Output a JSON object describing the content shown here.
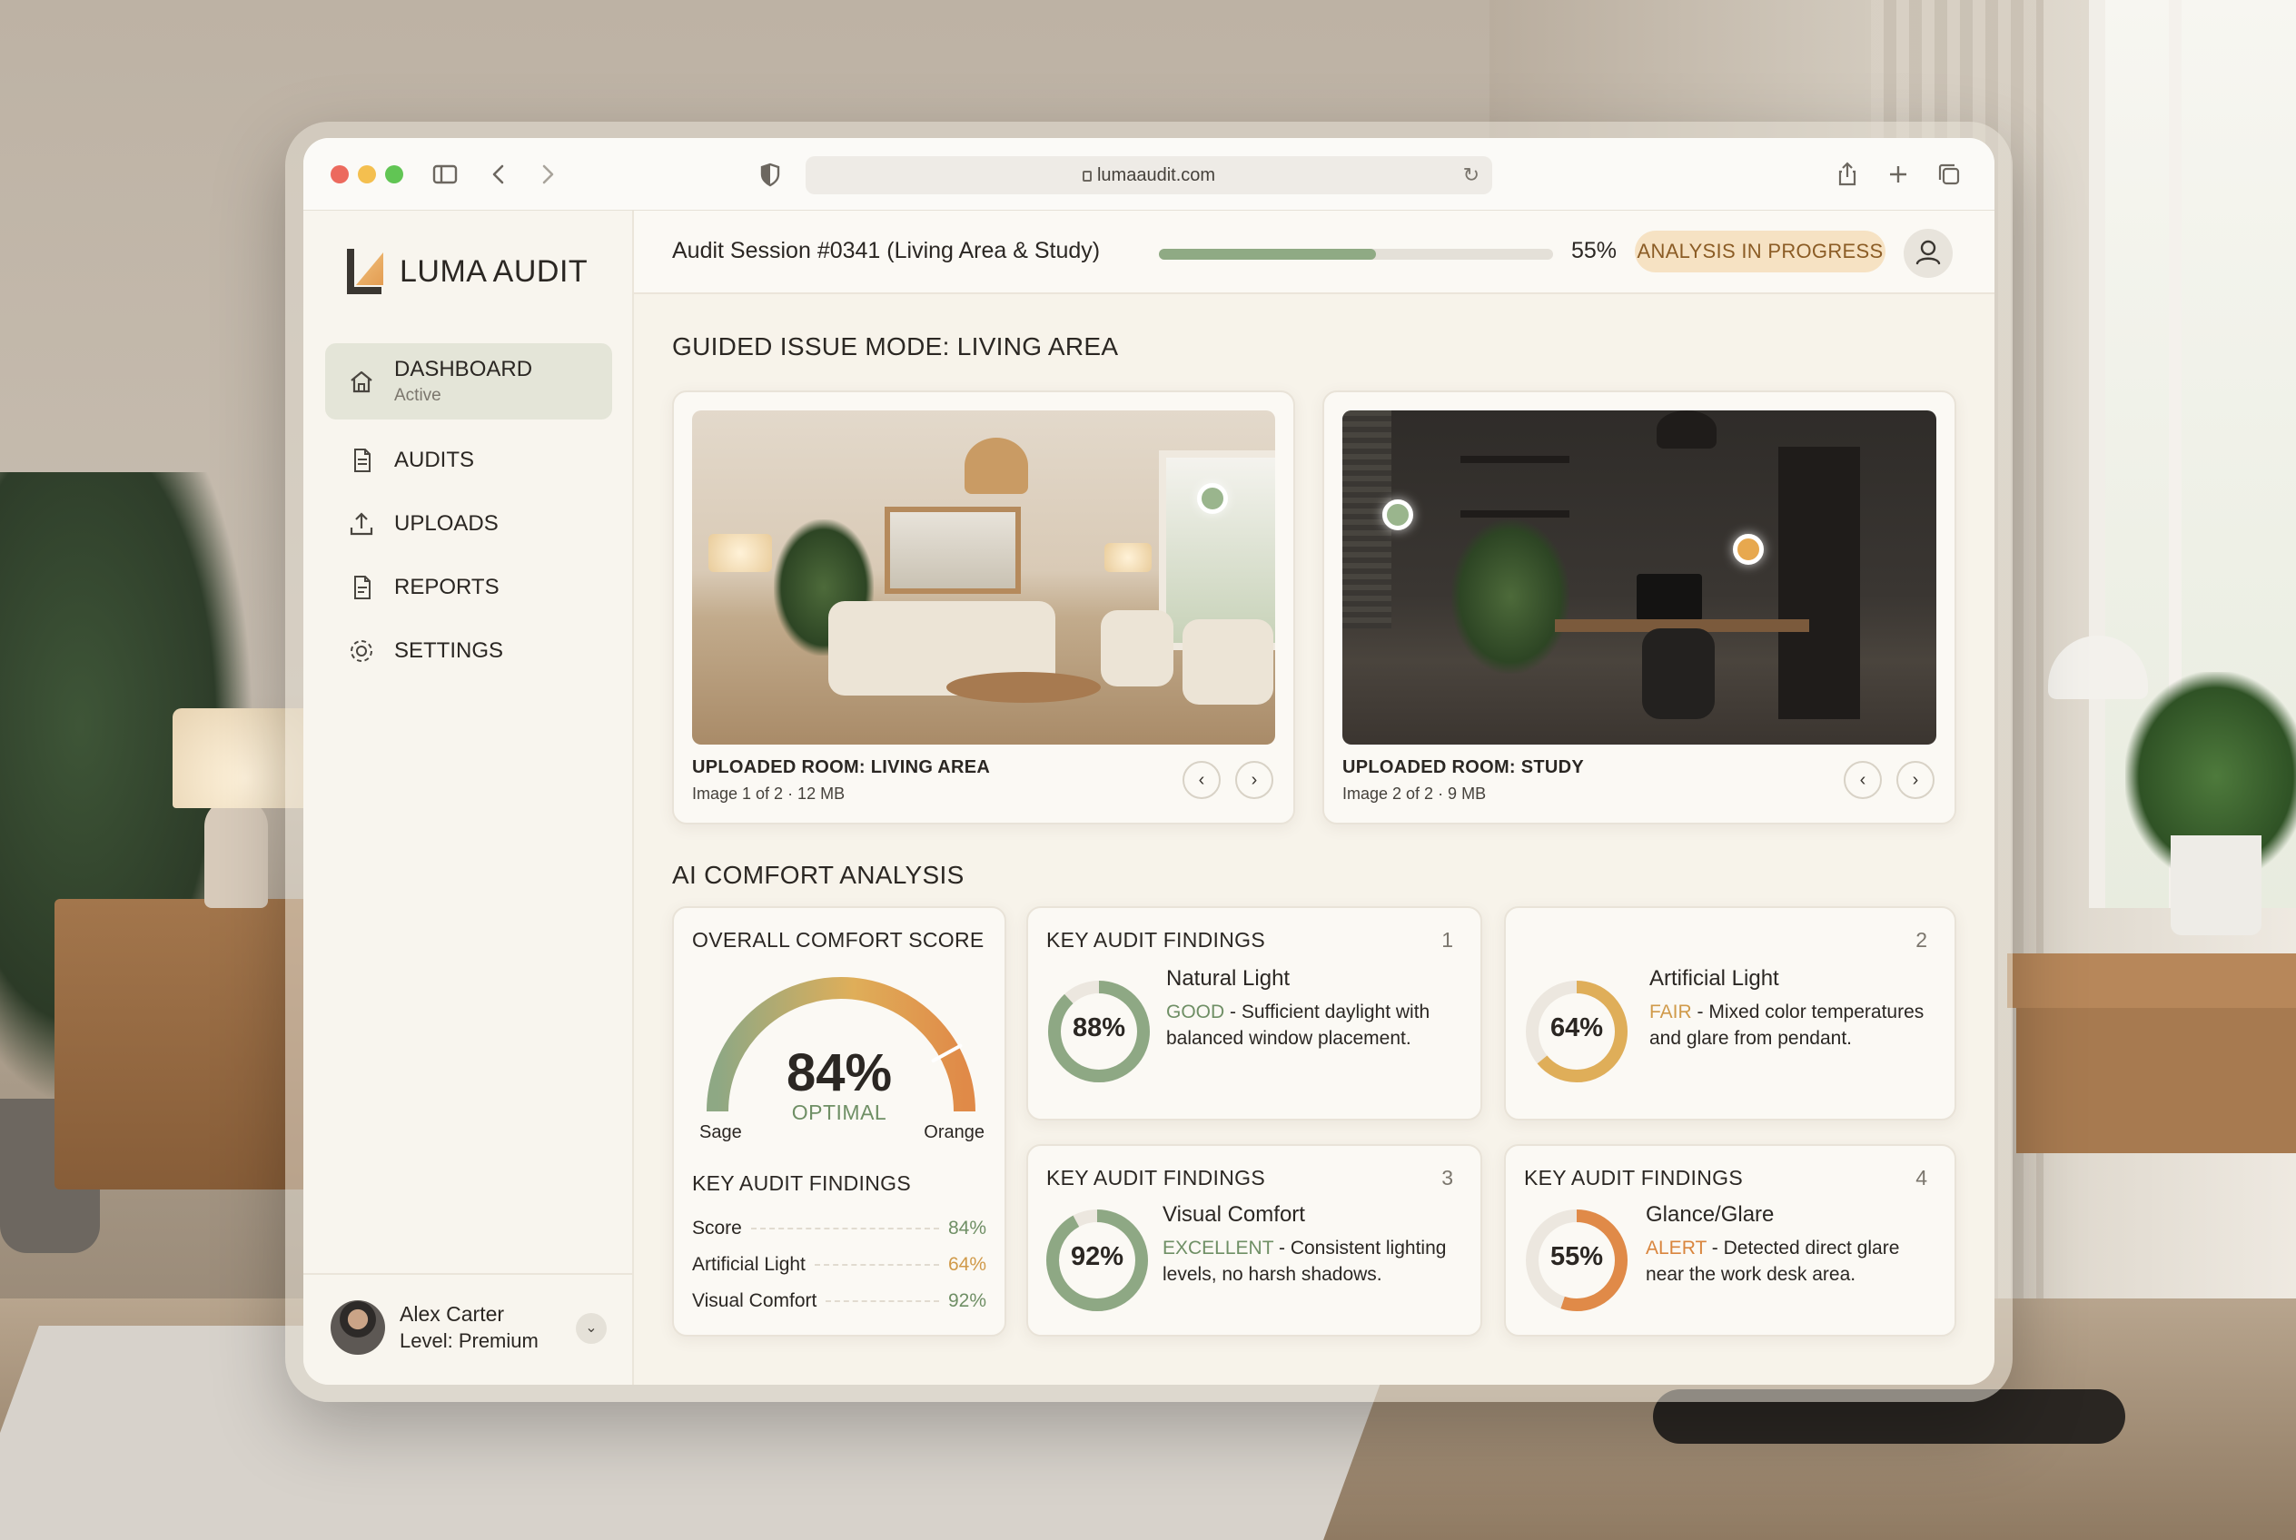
{
  "browser": {
    "url": "lumaaudit.com",
    "traffic_colors": [
      "#ec6a5e",
      "#f4bf4f",
      "#61c554"
    ]
  },
  "brand": {
    "name": "LUMA AUDIT"
  },
  "nav": {
    "items": [
      {
        "label": "DASHBOARD",
        "sublabel": "Active",
        "icon": "home-icon"
      },
      {
        "label": "AUDITS",
        "icon": "document-icon"
      },
      {
        "label": "UPLOADS",
        "icon": "upload-icon"
      },
      {
        "label": "REPORTS",
        "icon": "report-icon"
      },
      {
        "label": "SETTINGS",
        "icon": "gear-icon"
      }
    ]
  },
  "user": {
    "name": "Alex Carter",
    "level": "Level: Premium"
  },
  "topbar": {
    "session": "Audit Session #0341 (Living Area & Study)",
    "progress": 0.55,
    "progress_label": "55%",
    "status": "ANALYSIS IN PROGRESS"
  },
  "guided": {
    "title": "GUIDED ISSUE MODE: LIVING AREA",
    "rooms": [
      {
        "title": "UPLOADED ROOM: LIVING AREA",
        "meta": "Image 1 of 2 · 12 MB"
      },
      {
        "title": "UPLOADED ROOM: STUDY",
        "meta": "Image 2 of 2 · 9 MB"
      }
    ]
  },
  "analysis": {
    "title": "AI COMFORT ANALYSIS",
    "overall": {
      "title": "OVERALL COMFORT SCORE",
      "value": 84,
      "value_label": "84%",
      "state": "OPTIMAL",
      "min_label": "Sage",
      "max_label": "Orange",
      "findings_title": "KEY AUDIT FINDINGS",
      "rows": [
        {
          "label": "Score",
          "value": "84%",
          "color": "#6f8f65"
        },
        {
          "label": "Artificial Light",
          "value": "64%",
          "color": "#d09a4a"
        },
        {
          "label": "Visual Comfort",
          "value": "92%",
          "color": "#6f8f65"
        }
      ]
    },
    "findings": [
      {
        "header": "KEY AUDIT FINDINGS",
        "num": "1",
        "title": "Natural Light",
        "value": 88,
        "value_label": "88%",
        "tag": "GOOD",
        "tag_color": "#6f8f65",
        "ring_color": "#8ea884",
        "text": " - Sufficient daylight with balanced window placement."
      },
      {
        "header": "",
        "num": "2",
        "title": "Artificial Light",
        "value": 64,
        "value_label": "64%",
        "tag": "FAIR",
        "tag_color": "#d09a4a",
        "ring_color": "#dfae59",
        "text": " - Mixed color temperatures and glare from pendant."
      },
      {
        "header": "KEY AUDIT FINDINGS",
        "num": "3",
        "title": "Visual Comfort",
        "value": 92,
        "value_label": "92%",
        "tag": "EXCELLENT",
        "tag_color": "#6f8f65",
        "ring_color": "#8ea884",
        "text": " - Consistent lighting levels, no harsh shadows."
      },
      {
        "header": "KEY AUDIT FINDINGS",
        "num": "4",
        "title": "Glance/Glare",
        "value": 55,
        "value_label": "55%",
        "tag": "ALERT",
        "tag_color": "#d9853d",
        "ring_color": "#e08a48",
        "text": " - Detected direct glare near the work desk area."
      }
    ]
  },
  "colors": {
    "sage": "#8ea884",
    "amber": "#dfae59",
    "orange": "#e08a48",
    "track": "#ece7df"
  }
}
